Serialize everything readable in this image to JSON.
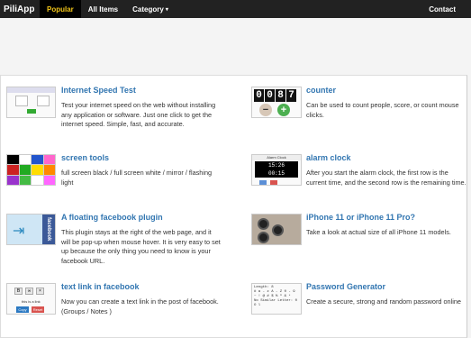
{
  "nav": {
    "brand": "PiliApp",
    "items": [
      {
        "label": "Popular",
        "active": true
      },
      {
        "label": "All Items",
        "active": false
      },
      {
        "label": "Category",
        "active": false
      }
    ],
    "contact": "Contact"
  },
  "apps": [
    {
      "title": "Internet Speed Test",
      "desc": "Test your internet speed on the web without installing any application or software. Just one click to get the internet speed. Simple, fast, and accurate."
    },
    {
      "title": "counter",
      "desc": "Can be used to count people, score, or count mouse clicks."
    },
    {
      "title": "screen tools",
      "desc": "full screen black / full screen white / mirror / flashing light"
    },
    {
      "title": "alarm clock",
      "desc": "After you start the alarm clock, the first row is the current time, and the second row is the remaining time."
    },
    {
      "title": "A floating facebook plugin",
      "desc": "This plugin stays at the right of the web page, and it will be pop-up when mouse hover. It is very easy to set up because the only thing you need to know is your facebook URL."
    },
    {
      "title": "iPhone 11 or iPhone 11 Pro?",
      "desc": "Take a look at actual size of all iPhone 11 models."
    },
    {
      "title": "text link in facebook",
      "desc": "Now you can create a text link in the post of facebook. (Groups / Notes )"
    },
    {
      "title": "Password Generator",
      "desc": "Create a secure, strong and random password online"
    }
  ],
  "thumbs": {
    "counter_digits": [
      "0",
      "0",
      "8",
      "7"
    ],
    "counter_minus": "−",
    "counter_plus": "+",
    "alarm_header": "Alarm Clock",
    "alarm_time": "15:26",
    "alarm_remaining": "00:15",
    "fb_label": "facebook",
    "tl_text": "this is a link",
    "tl_copy": "Copy",
    "tl_reset": "Reset",
    "pw_line1": "Length:  8",
    "pw_line2": "# a - z A - Z 0 - 9",
    "pw_line3": "~ ! @ # $ % ^ & *",
    "pw_line4": "No Similar Letter: 0 O l",
    "screen_colors": [
      "#000000",
      "#ffffff",
      "#2255cc",
      "#ff66cc",
      "#cc2222",
      "#22aa22",
      "#ffdd00",
      "#ff8800",
      "#9933cc",
      "#44bb44",
      "#ffffff",
      "#ff66ff"
    ]
  }
}
